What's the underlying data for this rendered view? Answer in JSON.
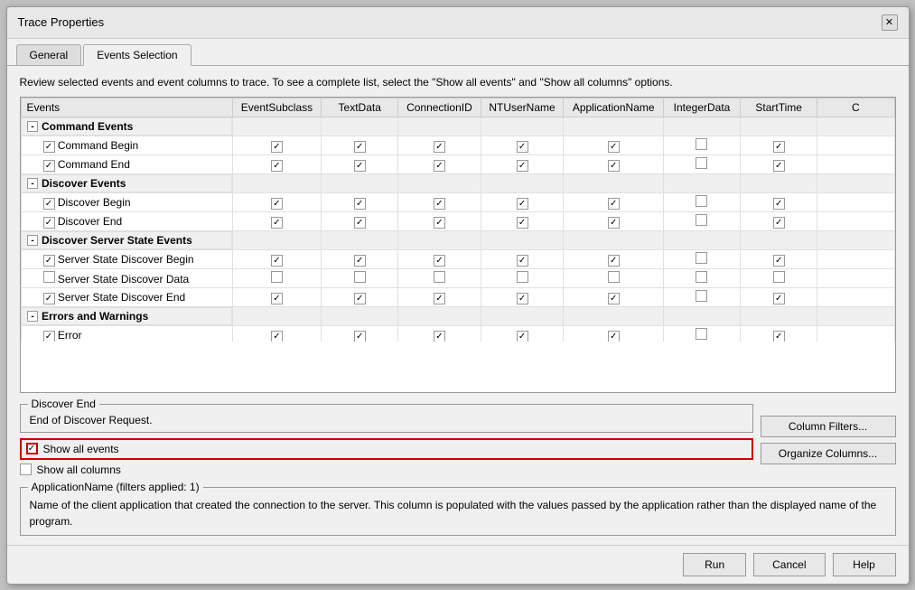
{
  "dialog": {
    "title": "Trace Properties",
    "close_label": "✕"
  },
  "tabs": [
    {
      "label": "General",
      "active": false
    },
    {
      "label": "Events Selection",
      "active": true
    }
  ],
  "instructions": "Review selected events and event columns to trace. To see a complete list, select the \"Show all events\" and \"Show all columns\" options.",
  "table": {
    "columns": [
      "Events",
      "EventSubclass",
      "TextData",
      "ConnectionID",
      "NTUserName",
      "ApplicationName",
      "IntegerData",
      "StartTime",
      "C"
    ],
    "groups": [
      {
        "label": "Command Events",
        "expanded": true,
        "rows": [
          {
            "name": "Command Begin",
            "cols": [
              true,
              true,
              true,
              true,
              true,
              false,
              true
            ]
          },
          {
            "name": "Command End",
            "cols": [
              true,
              true,
              true,
              true,
              true,
              false,
              true
            ]
          }
        ]
      },
      {
        "label": "Discover Events",
        "expanded": true,
        "rows": [
          {
            "name": "Discover Begin",
            "cols": [
              true,
              true,
              true,
              true,
              true,
              false,
              true
            ]
          },
          {
            "name": "Discover End",
            "cols": [
              true,
              true,
              true,
              true,
              true,
              false,
              true
            ]
          }
        ]
      },
      {
        "label": "Discover Server State Events",
        "expanded": true,
        "rows": [
          {
            "name": "Server State Discover Begin",
            "cols": [
              true,
              true,
              true,
              true,
              true,
              false,
              true
            ]
          },
          {
            "name": "Server State Discover Data",
            "cols": [
              false,
              false,
              false,
              false,
              false,
              false,
              false
            ]
          },
          {
            "name": "Server State Discover End",
            "cols": [
              true,
              true,
              true,
              true,
              true,
              false,
              true
            ]
          }
        ]
      },
      {
        "label": "Errors and Warnings",
        "expanded": true,
        "rows": [
          {
            "name": "Error",
            "cols": [
              true,
              true,
              true,
              true,
              true,
              false,
              true
            ]
          }
        ]
      }
    ]
  },
  "discover_end": {
    "legend": "Discover End",
    "description": "End of Discover Request."
  },
  "show_options": {
    "show_all_events_label": "Show all events",
    "show_all_events_checked": true,
    "show_all_columns_label": "Show all columns",
    "show_all_columns_checked": false
  },
  "app_name_box": {
    "legend": "ApplicationName (filters applied: 1)",
    "description": "Name of the client application that created the connection to the server. This column is populated with the values passed by the application rather than the displayed name of the program."
  },
  "action_buttons": {
    "column_filters": "Column Filters...",
    "organize_columns": "Organize Columns..."
  },
  "footer": {
    "run": "Run",
    "cancel": "Cancel",
    "help": "Help"
  }
}
